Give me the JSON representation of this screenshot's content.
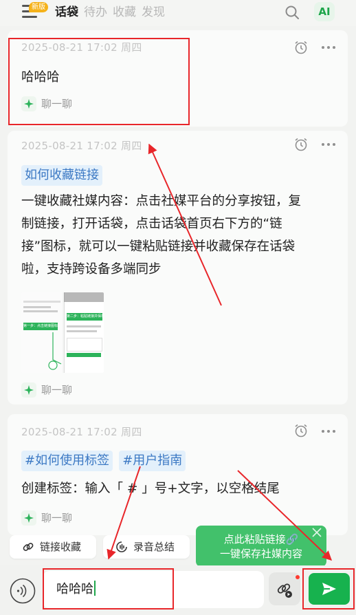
{
  "header": {
    "menu_icon": "hamburger-menu-icon",
    "new_badge": "新版",
    "tabs": [
      {
        "label": "话袋",
        "active": true
      },
      {
        "label": "待办",
        "active": false
      },
      {
        "label": "收藏",
        "active": false
      },
      {
        "label": "发现",
        "active": false
      }
    ],
    "search_icon": "search-icon",
    "ai_label": "AI"
  },
  "cards": [
    {
      "time": "2025-08-21 17:02 周四",
      "text": "哈哈哈",
      "chat_label": "聊一聊"
    },
    {
      "time": "2025-08-21 17:02 周四",
      "tag": "如何收藏链接",
      "lines": [
        "一键收藏社媒内容：点击社媒平台的分享按钮，复",
        "制链接，打开话袋，点击话袋首页右下方的“链",
        "接”图标，就可以一键粘贴链接并收藏保存在话袋",
        "啦，支持跨设备多端同步"
      ],
      "thumbnail": {
        "step1": "第一步：点击链接图标",
        "step2": "第二步：粘贴链接并保存"
      },
      "chat_label": "聊一聊"
    },
    {
      "time": "2025-08-21 17:02 周四",
      "tags": [
        "#如何使用标签",
        "#用户指南"
      ],
      "text": "创建标签：输入「 # 」号+文字，以空格结尾",
      "chat_label": "聊一聊"
    }
  ],
  "quick_actions": [
    {
      "label": "链接收藏",
      "icon": "link-icon"
    },
    {
      "label": "录音总结",
      "icon": "record-summary-icon"
    }
  ],
  "tooltip": {
    "line1": "点此粘贴链接🔗",
    "line2": "一键保存社媒内容"
  },
  "composer": {
    "voice_icon": "voice-input-icon",
    "input_value": "哈哈哈",
    "link_icon": "link-paste-icon",
    "send_icon": "send-icon"
  },
  "colors": {
    "brand_green": "#17b24e",
    "annotation_red": "#e8262a",
    "tag_blue": "#3c79c4"
  }
}
